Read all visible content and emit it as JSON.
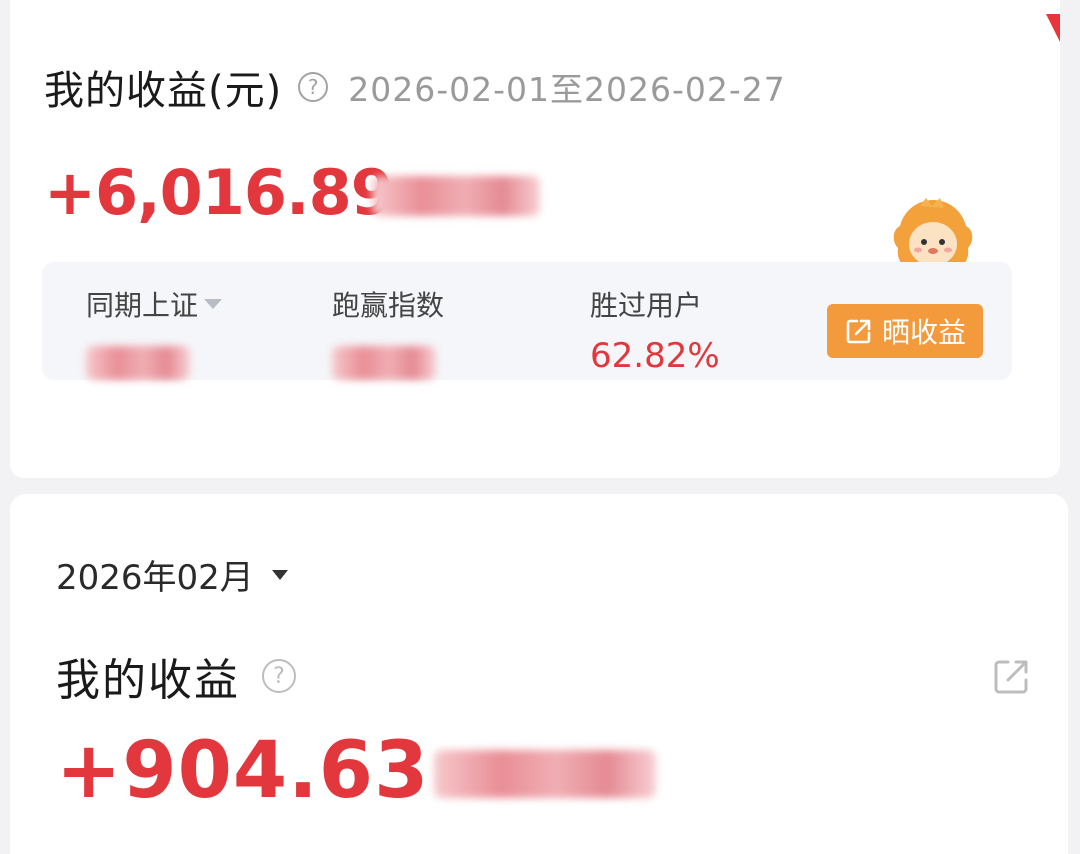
{
  "summary": {
    "title": "我的收益(元)",
    "help_glyph": "?",
    "date_range": "2026-02-01至2026-02-27",
    "total_profit": "+6,016.89",
    "stats": [
      {
        "label": "同期上证",
        "has_dropdown": true
      },
      {
        "label": "跑赢指数"
      },
      {
        "label": "胜过用户",
        "value": "62.82%"
      }
    ],
    "share_button": "晒收益",
    "mascot_icon": "lion-mascot-icon"
  },
  "monthly": {
    "month": "2026年02月",
    "title": "我的收益",
    "help_glyph": "?",
    "profit": "+904.63"
  },
  "colors": {
    "profit_red": "#e2373d",
    "share_orange": "#f39a3d",
    "panel_bg": "#f5f6f9"
  }
}
